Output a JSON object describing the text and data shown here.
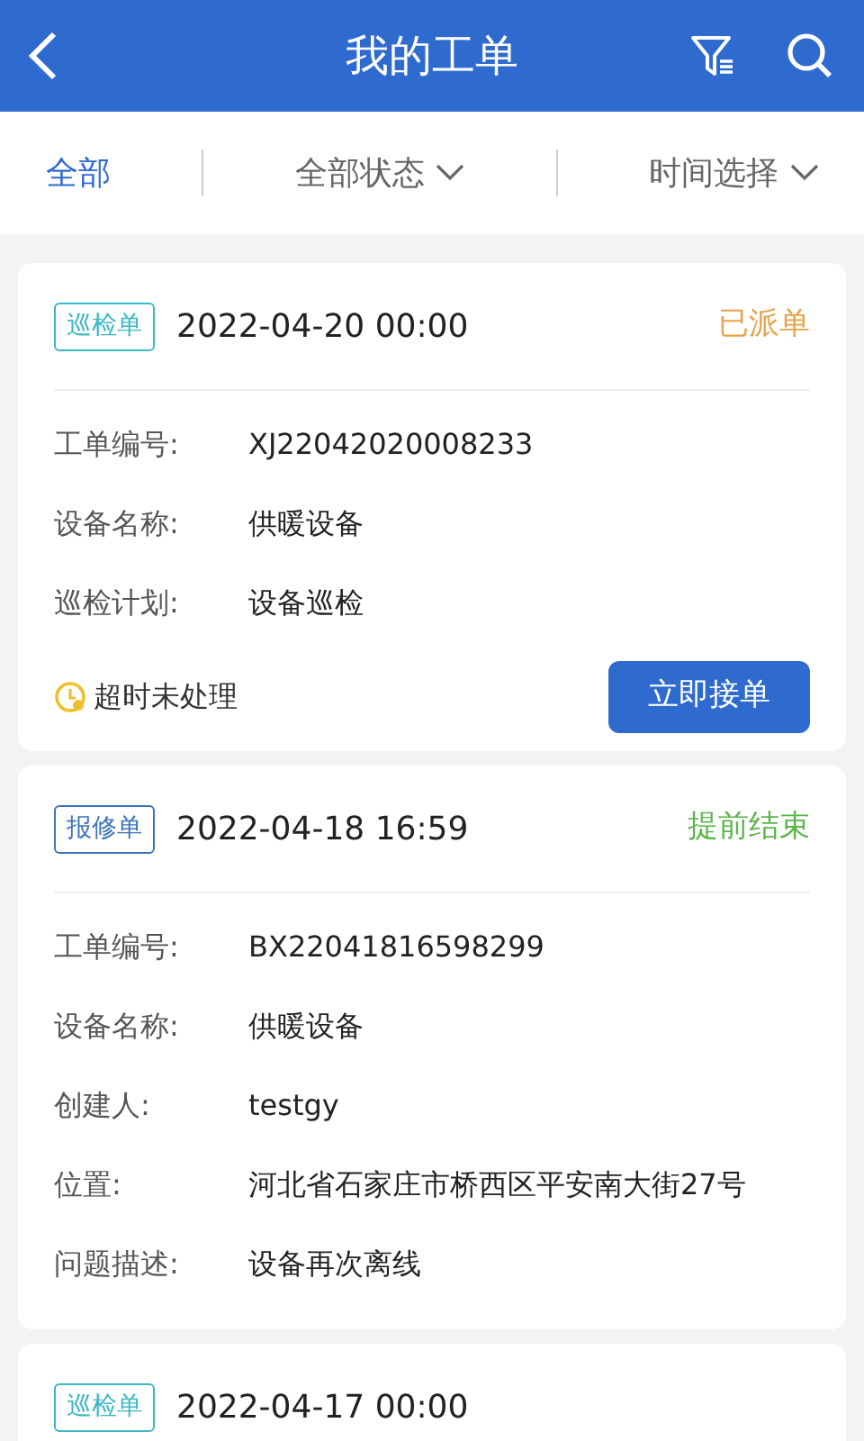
{
  "header": {
    "title": "我的工单"
  },
  "filters": [
    {
      "label": "全部",
      "selected": true,
      "dropdown": false
    },
    {
      "label": "全部状态",
      "selected": false,
      "dropdown": true
    },
    {
      "label": "时间选择",
      "selected": false,
      "dropdown": true
    }
  ],
  "orders": [
    {
      "tag": {
        "label": "巡检单",
        "color": "#3bb8c4"
      },
      "datetime": "2022-04-20 00:00",
      "status": {
        "label": "已派单",
        "color": "#e8a24a"
      },
      "fields": [
        {
          "label": "工单编号:",
          "value": "XJ22042020008233"
        },
        {
          "label": "设备名称:",
          "value": "供暖设备"
        },
        {
          "label": "巡检计划:",
          "value": "设备巡检"
        }
      ],
      "warning": "超时未处理",
      "action": "立即接单"
    },
    {
      "tag": {
        "label": "报修单",
        "color": "#3d74b8"
      },
      "datetime": "2022-04-18 16:59",
      "status": {
        "label": "提前结束",
        "color": "#5bb54a"
      },
      "fields": [
        {
          "label": "工单编号:",
          "value": "BX22041816598299"
        },
        {
          "label": "设备名称:",
          "value": "供暖设备"
        },
        {
          "label": "创建人:",
          "value": "testgy"
        },
        {
          "label": "位置:",
          "value": "河北省石家庄市桥西区平安南大街27号"
        },
        {
          "label": "问题描述:",
          "value": "设备再次离线"
        }
      ]
    },
    {
      "tag": {
        "label": "巡检单",
        "color": "#3bb8c4"
      },
      "datetime": "2022-04-17 00:00"
    }
  ]
}
